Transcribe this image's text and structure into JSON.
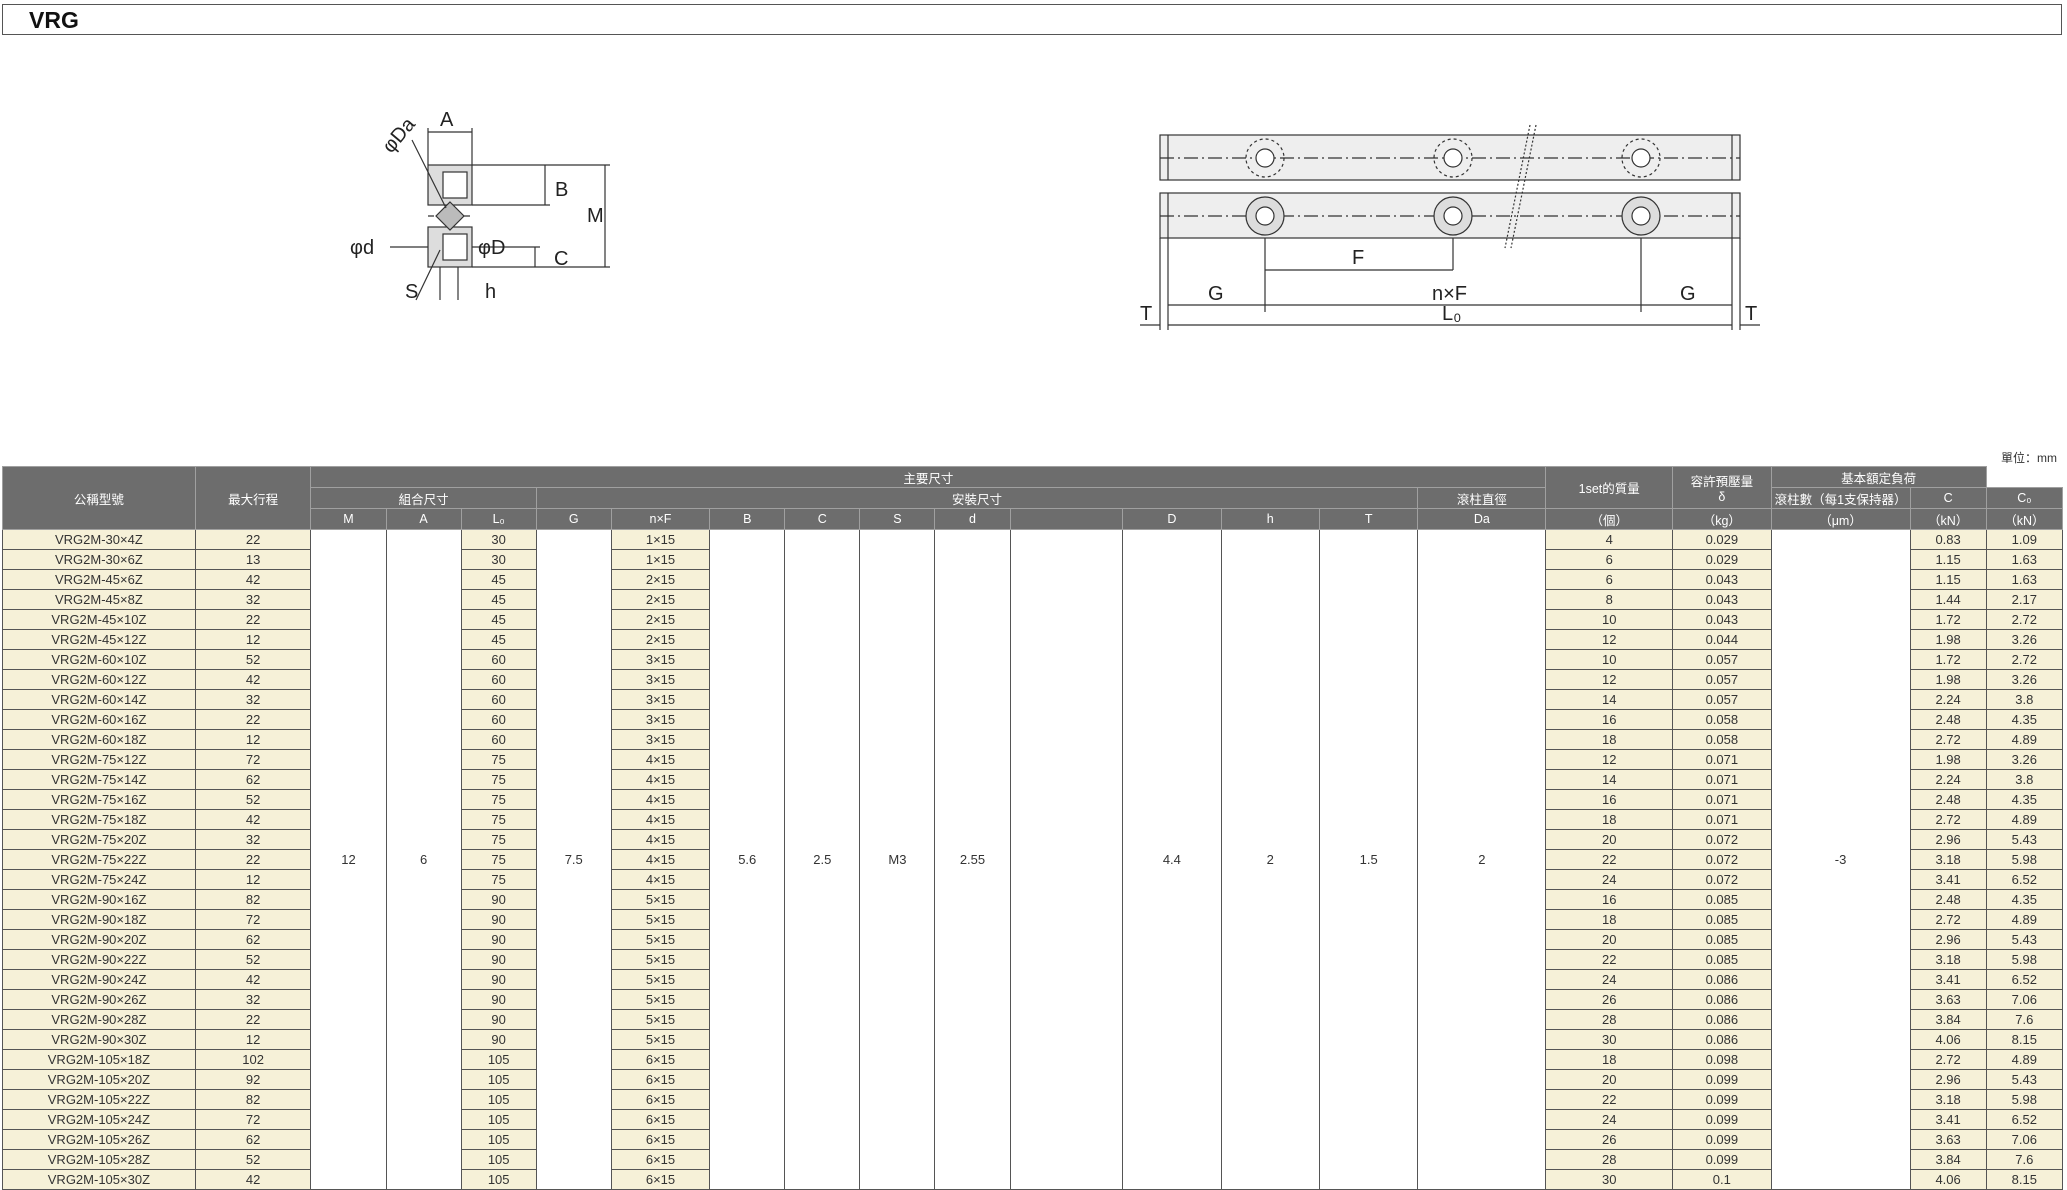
{
  "title": "VRG",
  "unit": "單位：mm",
  "diagram_labels": {
    "left": {
      "A": "A",
      "Da": "φDa",
      "B": "B",
      "M": "M",
      "d": "φd",
      "D": "φD",
      "C": "C",
      "S": "S",
      "h": "h"
    },
    "right": {
      "F": "F",
      "G": "G",
      "nF": "n×F",
      "T": "T",
      "L0": "L₀"
    }
  },
  "headers": {
    "model": "公稱型號",
    "stroke": "最大行程",
    "main_dims": "主要尺寸",
    "combo_dims": "組合尺寸",
    "mount_dims": "安裝尺寸",
    "roller_dia": "滾柱直徑",
    "roller_count": "滾柱數（每1支保持器）",
    "roller_count_unit": "（個）",
    "mass": "1set的質量",
    "mass_unit": "（kg）",
    "preload": "容許預壓量",
    "preload_sym": "δ",
    "preload_unit": "（μm）",
    "load": "基本額定負荷",
    "C": "C",
    "C0": "C₀",
    "kN1": "（kN）",
    "kN2": "（kN）",
    "cols": [
      "M",
      "A",
      "L₀",
      "G",
      "n×F",
      "B",
      "C",
      "S",
      "d",
      "",
      "D",
      "h",
      "T",
      "Da"
    ]
  },
  "common": {
    "M": "12",
    "A": "6",
    "G": "7.5",
    "B": "5.6",
    "C": "2.5",
    "S": "M3",
    "d": "2.55",
    "D": "4.4",
    "h": "2",
    "T": "1.5",
    "Da": "2",
    "preload": "-3"
  },
  "rows": [
    {
      "model": "VRG2M-30×4Z",
      "stroke": "22",
      "L0": "30",
      "nF": "1×15",
      "n": "4",
      "mass": "0.029",
      "C": "0.83",
      "C0": "1.09"
    },
    {
      "model": "VRG2M-30×6Z",
      "stroke": "13",
      "L0": "30",
      "nF": "1×15",
      "n": "6",
      "mass": "0.029",
      "C": "1.15",
      "C0": "1.63"
    },
    {
      "model": "VRG2M-45×6Z",
      "stroke": "42",
      "L0": "45",
      "nF": "2×15",
      "n": "6",
      "mass": "0.043",
      "C": "1.15",
      "C0": "1.63"
    },
    {
      "model": "VRG2M-45×8Z",
      "stroke": "32",
      "L0": "45",
      "nF": "2×15",
      "n": "8",
      "mass": "0.043",
      "C": "1.44",
      "C0": "2.17"
    },
    {
      "model": "VRG2M-45×10Z",
      "stroke": "22",
      "L0": "45",
      "nF": "2×15",
      "n": "10",
      "mass": "0.043",
      "C": "1.72",
      "C0": "2.72"
    },
    {
      "model": "VRG2M-45×12Z",
      "stroke": "12",
      "L0": "45",
      "nF": "2×15",
      "n": "12",
      "mass": "0.044",
      "C": "1.98",
      "C0": "3.26"
    },
    {
      "model": "VRG2M-60×10Z",
      "stroke": "52",
      "L0": "60",
      "nF": "3×15",
      "n": "10",
      "mass": "0.057",
      "C": "1.72",
      "C0": "2.72"
    },
    {
      "model": "VRG2M-60×12Z",
      "stroke": "42",
      "L0": "60",
      "nF": "3×15",
      "n": "12",
      "mass": "0.057",
      "C": "1.98",
      "C0": "3.26"
    },
    {
      "model": "VRG2M-60×14Z",
      "stroke": "32",
      "L0": "60",
      "nF": "3×15",
      "n": "14",
      "mass": "0.057",
      "C": "2.24",
      "C0": "3.8"
    },
    {
      "model": "VRG2M-60×16Z",
      "stroke": "22",
      "L0": "60",
      "nF": "3×15",
      "n": "16",
      "mass": "0.058",
      "C": "2.48",
      "C0": "4.35"
    },
    {
      "model": "VRG2M-60×18Z",
      "stroke": "12",
      "L0": "60",
      "nF": "3×15",
      "n": "18",
      "mass": "0.058",
      "C": "2.72",
      "C0": "4.89"
    },
    {
      "model": "VRG2M-75×12Z",
      "stroke": "72",
      "L0": "75",
      "nF": "4×15",
      "n": "12",
      "mass": "0.071",
      "C": "1.98",
      "C0": "3.26"
    },
    {
      "model": "VRG2M-75×14Z",
      "stroke": "62",
      "L0": "75",
      "nF": "4×15",
      "n": "14",
      "mass": "0.071",
      "C": "2.24",
      "C0": "3.8"
    },
    {
      "model": "VRG2M-75×16Z",
      "stroke": "52",
      "L0": "75",
      "nF": "4×15",
      "n": "16",
      "mass": "0.071",
      "C": "2.48",
      "C0": "4.35"
    },
    {
      "model": "VRG2M-75×18Z",
      "stroke": "42",
      "L0": "75",
      "nF": "4×15",
      "n": "18",
      "mass": "0.071",
      "C": "2.72",
      "C0": "4.89"
    },
    {
      "model": "VRG2M-75×20Z",
      "stroke": "32",
      "L0": "75",
      "nF": "4×15",
      "n": "20",
      "mass": "0.072",
      "C": "2.96",
      "C0": "5.43"
    },
    {
      "model": "VRG2M-75×22Z",
      "stroke": "22",
      "L0": "75",
      "nF": "4×15",
      "n": "22",
      "mass": "0.072",
      "C": "3.18",
      "C0": "5.98"
    },
    {
      "model": "VRG2M-75×24Z",
      "stroke": "12",
      "L0": "75",
      "nF": "4×15",
      "n": "24",
      "mass": "0.072",
      "C": "3.41",
      "C0": "6.52"
    },
    {
      "model": "VRG2M-90×16Z",
      "stroke": "82",
      "L0": "90",
      "nF": "5×15",
      "n": "16",
      "mass": "0.085",
      "C": "2.48",
      "C0": "4.35"
    },
    {
      "model": "VRG2M-90×18Z",
      "stroke": "72",
      "L0": "90",
      "nF": "5×15",
      "n": "18",
      "mass": "0.085",
      "C": "2.72",
      "C0": "4.89"
    },
    {
      "model": "VRG2M-90×20Z",
      "stroke": "62",
      "L0": "90",
      "nF": "5×15",
      "n": "20",
      "mass": "0.085",
      "C": "2.96",
      "C0": "5.43"
    },
    {
      "model": "VRG2M-90×22Z",
      "stroke": "52",
      "L0": "90",
      "nF": "5×15",
      "n": "22",
      "mass": "0.085",
      "C": "3.18",
      "C0": "5.98"
    },
    {
      "model": "VRG2M-90×24Z",
      "stroke": "42",
      "L0": "90",
      "nF": "5×15",
      "n": "24",
      "mass": "0.086",
      "C": "3.41",
      "C0": "6.52"
    },
    {
      "model": "VRG2M-90×26Z",
      "stroke": "32",
      "L0": "90",
      "nF": "5×15",
      "n": "26",
      "mass": "0.086",
      "C": "3.63",
      "C0": "7.06"
    },
    {
      "model": "VRG2M-90×28Z",
      "stroke": "22",
      "L0": "90",
      "nF": "5×15",
      "n": "28",
      "mass": "0.086",
      "C": "3.84",
      "C0": "7.6"
    },
    {
      "model": "VRG2M-90×30Z",
      "stroke": "12",
      "L0": "90",
      "nF": "5×15",
      "n": "30",
      "mass": "0.086",
      "C": "4.06",
      "C0": "8.15"
    },
    {
      "model": "VRG2M-105×18Z",
      "stroke": "102",
      "L0": "105",
      "nF": "6×15",
      "n": "18",
      "mass": "0.098",
      "C": "2.72",
      "C0": "4.89"
    },
    {
      "model": "VRG2M-105×20Z",
      "stroke": "92",
      "L0": "105",
      "nF": "6×15",
      "n": "20",
      "mass": "0.099",
      "C": "2.96",
      "C0": "5.43"
    },
    {
      "model": "VRG2M-105×22Z",
      "stroke": "82",
      "L0": "105",
      "nF": "6×15",
      "n": "22",
      "mass": "0.099",
      "C": "3.18",
      "C0": "5.98"
    },
    {
      "model": "VRG2M-105×24Z",
      "stroke": "72",
      "L0": "105",
      "nF": "6×15",
      "n": "24",
      "mass": "0.099",
      "C": "3.41",
      "C0": "6.52"
    },
    {
      "model": "VRG2M-105×26Z",
      "stroke": "62",
      "L0": "105",
      "nF": "6×15",
      "n": "26",
      "mass": "0.099",
      "C": "3.63",
      "C0": "7.06"
    },
    {
      "model": "VRG2M-105×28Z",
      "stroke": "52",
      "L0": "105",
      "nF": "6×15",
      "n": "28",
      "mass": "0.099",
      "C": "3.84",
      "C0": "7.6"
    },
    {
      "model": "VRG2M-105×30Z",
      "stroke": "42",
      "L0": "105",
      "nF": "6×15",
      "n": "30",
      "mass": "0.1",
      "C": "4.06",
      "C0": "8.15"
    }
  ]
}
